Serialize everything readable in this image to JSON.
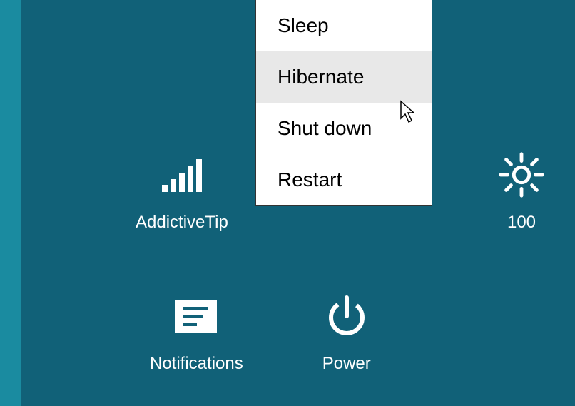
{
  "settings_panel": {
    "network": {
      "label": "AddictiveTip"
    },
    "brightness": {
      "value": "100"
    },
    "notifications": {
      "label": "Notifications"
    },
    "power": {
      "label": "Power"
    }
  },
  "power_menu": {
    "items": [
      {
        "label": "Sleep",
        "hover": false
      },
      {
        "label": "Hibernate",
        "hover": true
      },
      {
        "label": "Shut down",
        "hover": false
      },
      {
        "label": "Restart",
        "hover": false
      }
    ]
  }
}
